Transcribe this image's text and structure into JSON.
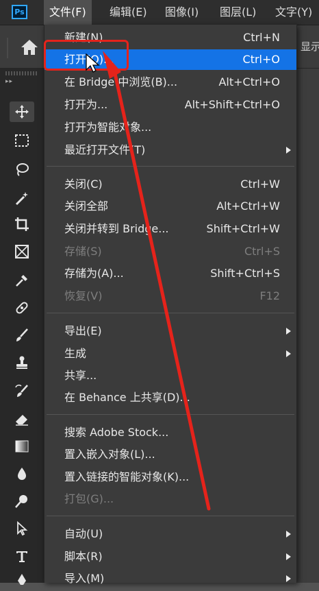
{
  "app": {
    "logo_text": "Ps"
  },
  "menubar": {
    "items": [
      {
        "label": "文件(F)",
        "active": true
      },
      {
        "label": "编辑(E)"
      },
      {
        "label": "图像(I)"
      },
      {
        "label": "图层(L)"
      },
      {
        "label": "文字(Y)"
      }
    ]
  },
  "options_bar": {
    "show_label": "显示"
  },
  "tools": [
    "move-tool-icon",
    "marquee-tool-icon",
    "lasso-tool-icon",
    "magic-wand-tool-icon",
    "crop-tool-icon",
    "frame-tool-icon",
    "eyedropper-tool-icon",
    "healing-brush-tool-icon",
    "brush-tool-icon",
    "clone-stamp-tool-icon",
    "history-brush-tool-icon",
    "eraser-tool-icon",
    "gradient-tool-icon",
    "blur-tool-icon",
    "dodge-tool-icon",
    "path-selection-tool-icon",
    "type-tool-icon",
    "pen-tool-icon"
  ],
  "file_menu": {
    "items": [
      {
        "label": "新建(N)...",
        "shortcut": "Ctrl+N"
      },
      {
        "label": "打开(O)...",
        "shortcut": "Ctrl+O",
        "highlighted": true
      },
      {
        "label": "在 Bridge 中浏览(B)...",
        "shortcut": "Alt+Ctrl+O"
      },
      {
        "label": "打开为...",
        "shortcut": "Alt+Shift+Ctrl+O"
      },
      {
        "label": "打开为智能对象..."
      },
      {
        "label": "最近打开文件(T)",
        "submenu": true
      },
      {
        "label": "关闭(C)",
        "shortcut": "Ctrl+W"
      },
      {
        "label": "关闭全部",
        "shortcut": "Alt+Ctrl+W"
      },
      {
        "label": "关闭并转到 Bridge...",
        "shortcut": "Shift+Ctrl+W"
      },
      {
        "label": "存储(S)",
        "shortcut": "Ctrl+S",
        "disabled": true
      },
      {
        "label": "存储为(A)...",
        "shortcut": "Shift+Ctrl+S"
      },
      {
        "label": "恢复(V)",
        "shortcut": "F12",
        "disabled": true
      },
      {
        "label": "导出(E)",
        "submenu": true
      },
      {
        "label": "生成",
        "submenu": true
      },
      {
        "label": "共享..."
      },
      {
        "label": "在 Behance 上共享(D)..."
      },
      {
        "label": "搜索 Adobe Stock..."
      },
      {
        "label": "置入嵌入对象(L)..."
      },
      {
        "label": "置入链接的智能对象(K)..."
      },
      {
        "label": "打包(G)...",
        "disabled": true
      },
      {
        "label": "自动(U)",
        "submenu": true
      },
      {
        "label": "脚本(R)",
        "submenu": true
      },
      {
        "label": "导入(M)",
        "submenu": true
      }
    ]
  },
  "colors": {
    "highlight": "#1473e6",
    "annotation_red": "#e5231b",
    "menu_bg": "#3b3b3b"
  }
}
